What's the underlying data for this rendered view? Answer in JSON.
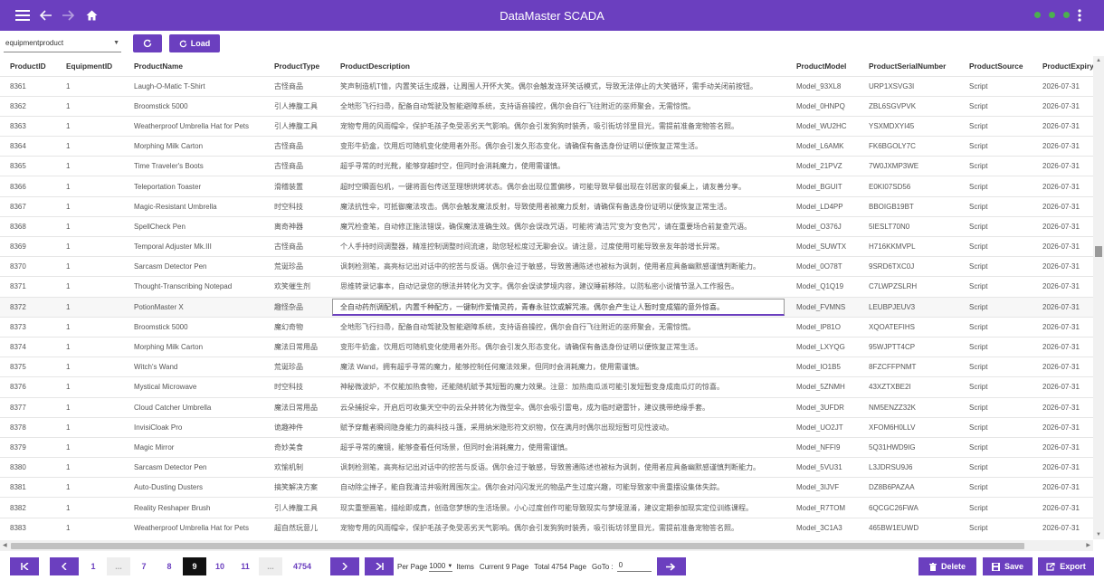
{
  "app": {
    "title": "DataMaster SCADA"
  },
  "toolbar": {
    "table_select": "equipmentproduct",
    "load_label": "Load"
  },
  "columns": [
    "ProductID",
    "EquipmentID",
    "ProductName",
    "ProductType",
    "ProductDescription",
    "ProductModel",
    "ProductSerialNumber",
    "ProductSource",
    "ProductExpiry"
  ],
  "rows": [
    [
      "8361",
      "1",
      "Laugh-O-Matic T-Shirt",
      "古怪商品",
      "笑声制造机T恤，内置笑话生成器，让周围人开怀大笑。偶尔会触发连环笑话模式，导致无法停止的大笑循环，需手动关闭前按钮。",
      "Model_93XL8",
      "URP1XSVG3I",
      "Script",
      "2026-07-31"
    ],
    [
      "8362",
      "1",
      "Broomstick 5000",
      "引人捧腹工具",
      "全地形飞行扫帚，配备自动驾驶及智能避障系统，支持语音操控，偶尔会自行飞往附近的巫师聚会，无需惊慌。",
      "Model_0HNPQ",
      "ZBL6SGVPVK",
      "Script",
      "2026-07-31"
    ],
    [
      "8363",
      "1",
      "Weatherproof Umbrella Hat for Pets",
      "引人捧腹工具",
      "宠物专用的风雨帽伞，保护毛孩子免受恶劣天气影响。偶尔会引发狗狗时装秀，吸引街坊邻里目光，需提前准备宠物答名照。",
      "Model_WU2HC",
      "YSXMDXYI45",
      "Script",
      "2026-07-31"
    ],
    [
      "8364",
      "1",
      "Morphing Milk Carton",
      "古怪商品",
      "变形牛奶盒，饮用后可随机变化使用者外形。偶尔会引发久形态变化，请确保有备选身份证明以便恢复正常生活。",
      "Model_L6AMK",
      "FK6BGOLY7C",
      "Script",
      "2026-07-31"
    ],
    [
      "8365",
      "1",
      "Time Traveler's Boots",
      "古怪商品",
      "超乎寻常的时光靴，能够穿越时空，但同时会消耗魔力，使用需谨慎。",
      "Model_21PVZ",
      "7W0JXMP3WE",
      "Script",
      "2026-07-31"
    ],
    [
      "8366",
      "1",
      "Teleportation Toaster",
      "滑稽装置",
      "超时空瞬面包机，一键将面包传送至理想烘烤状态。偶尔会出现位置偏移，可能导致早餐出现在邻居家的餐桌上，请友善分享。",
      "Model_BGUIT",
      "E0KI07SD56",
      "Script",
      "2026-07-31"
    ],
    [
      "8367",
      "1",
      "Magic-Resistant Umbrella",
      "时空科技",
      "魔法抗性伞，可抵御魔法攻击。偶尔会触发魔法反射，导致使用者被魔力反射，请确保有备选身份证明以便恢复正常生活。",
      "Model_LD4PP",
      "BBOIGB19BT",
      "Script",
      "2026-07-31"
    ],
    [
      "8368",
      "1",
      "SpellCheck Pen",
      "离奇神器",
      "魔咒检查笔，自动修正施法错误，确保魔法准确生效。偶尔会误改咒语，可能将'清洁咒'变为'变色咒'，请在重要场合前复查咒语。",
      "Model_O376J",
      "5IESLT70N0",
      "Script",
      "2026-07-31"
    ],
    [
      "8369",
      "1",
      "Temporal Adjuster Mk.III",
      "古怪商品",
      "个人手持时间调整器，精准控制调整时间流速，助您轻松度过无聊会议。请注意，过度使用可能导致亲友年龄增长异常。",
      "Model_SUWTX",
      "H716KKMVPL",
      "Script",
      "2026-07-31"
    ],
    [
      "8370",
      "1",
      "Sarcasm Detector Pen",
      "荒诞珍品",
      "讽刺检测笔，高亮标记出对话中的挖苦与反语。偶尔会过于敏感，导致普通陈述也被标为讽刺，使用者应具备幽默感谨慎判断能力。",
      "Model_0O78T",
      "9SRD6TXC0J",
      "Script",
      "2026-07-31"
    ],
    [
      "8371",
      "1",
      "Thought-Transcribing Notepad",
      "欢笑催生剂",
      "思维转录记事本，自动记录您的想法并转化为文字。偶尔会误读梦境内容，建议睡前移除，以防私密小说情节混入工作报告。",
      "Model_Q1Q19",
      "C7LWPZSLRH",
      "Script",
      "2026-07-31"
    ],
    [
      "8372",
      "1",
      "PotionMaster X",
      "趣怪杂品",
      "全自动药剂调配机，内置千种配方，一键制作爱情灵药，青春永驻饮或解咒液。偶尔会产生让人暂时变成猫的意外惊喜。",
      "Model_FVMNS",
      "LEUBPJEUV3",
      "Script",
      "2026-07-31"
    ],
    [
      "8373",
      "1",
      "Broomstick 5000",
      "魔幻奇物",
      "全地形飞行扫帚，配备自动驾驶及智能避障系统，支持语音操控，偶尔会自行飞往附近的巫师聚会，无需惊慌。",
      "Model_IP81O",
      "XQOATEFIHS",
      "Script",
      "2026-07-31"
    ],
    [
      "8374",
      "1",
      "Morphing Milk Carton",
      "魔法日常用品",
      "变形牛奶盒，饮用后可随机变化使用者外形。偶尔会引发久形态变化，请确保有备选身份证明以便恢复正常生活。",
      "Model_LXYQG",
      "95WJPTT4CP",
      "Script",
      "2026-07-31"
    ],
    [
      "8375",
      "1",
      "Witch's Wand",
      "荒诞珍品",
      "魔法 Wand，拥有超乎寻常的魔力，能够控制任何魔法效果，但同时会消耗魔力，使用需谨慎。",
      "Model_IO1B5",
      "8FZCFFPNMT",
      "Script",
      "2026-07-31"
    ],
    [
      "8376",
      "1",
      "Mystical Microwave",
      "时空科技",
      "神秘微波炉，不仅能加热食物，还能随机赋予其短暂的魔力效果。注意：加热南瓜派可能引发短暂变身成南瓜灯的惊喜。",
      "Model_5ZNMH",
      "43XZTXBE2I",
      "Script",
      "2026-07-31"
    ],
    [
      "8377",
      "1",
      "Cloud Catcher Umbrella",
      "魔法日常用品",
      "云朵捕捉伞，开启后可收集天空中的云朵并转化为微型伞。偶尔会吸引雷电，成为临时避雷针，建议携带绝缘手套。",
      "Model_3UFDR",
      "NM5ENZZ32K",
      "Script",
      "2026-07-31"
    ],
    [
      "8378",
      "1",
      "InvisiCloak Pro",
      "诡趣神件",
      "赋予穿戴者瞬间隐身能力的高科技斗篷，采用纳米隐形符文织物，仅在满月时偶尔出现短暂可见性波动。",
      "Model_UO2JT",
      "XFOM6H0LLV",
      "Script",
      "2026-07-31"
    ],
    [
      "8379",
      "1",
      "Magic Mirror",
      "奇妙美食",
      "超乎寻常的魔镜，能够查看任何场景，但同时会消耗魔力，使用需谨慎。",
      "Model_NFFI9",
      "5Q31HWD9IG",
      "Script",
      "2026-07-31"
    ],
    [
      "8380",
      "1",
      "Sarcasm Detector Pen",
      "欢愉机制",
      "讽刺检测笔，高亮标记出对话中的挖苦与反语。偶尔会过于敏感，导致普通陈述也被标为讽刺，使用者应具备幽默感谨慎判断能力。",
      "Model_5VU31",
      "L3JDRSU9J6",
      "Script",
      "2026-07-31"
    ],
    [
      "8381",
      "1",
      "Auto-Dusting Dusters",
      "搞笑解决方案",
      "自动除尘掸子，能自我清洁并吸附周围灰尘。偶尔会对闪闪发光的物品产生过度兴趣，可能导致家中贵重摆设集体失踪。",
      "Model_3IJVF",
      "DZ8B6PAZAA",
      "Script",
      "2026-07-31"
    ],
    [
      "8382",
      "1",
      "Reality Reshaper Brush",
      "引人捧腹工具",
      "现实重塑画笔，描绘即成真，创造您梦想的生活场景。小心过度创作可能导致现实与梦境混淆，建议定期参加现实定位训练课程。",
      "Model_R7TOM",
      "6QCGC26FWA",
      "Script",
      "2026-07-31"
    ],
    [
      "8383",
      "1",
      "Weatherproof Umbrella Hat for Pets",
      "超自然玩意儿",
      "宠物专用的风雨帽伞，保护毛孩子免受恶劣天气影响。偶尔会引发狗狗时装秀，吸引街坊邻里目光，需提前准备宠物答名照。",
      "Model_3C1A3",
      "465BW1EUWD",
      "Script",
      "2026-07-31"
    ]
  ],
  "pager": {
    "pages": [
      "1",
      "...",
      "7",
      "8",
      "9",
      "10",
      "11",
      "...",
      "4754"
    ],
    "current": "9",
    "per_page_label": "Per Page",
    "per_page": "1000",
    "items_label": "Items",
    "current_page_text": "Current 9 Page",
    "total_text": "Total 4754 Page",
    "goto_label": "GoTo :",
    "goto_value": "0"
  },
  "actions": {
    "delete": "Delete",
    "save": "Save",
    "export": "Export"
  },
  "colors": {
    "accent": "#6b3fbf",
    "status_dot": "#4caf50"
  }
}
